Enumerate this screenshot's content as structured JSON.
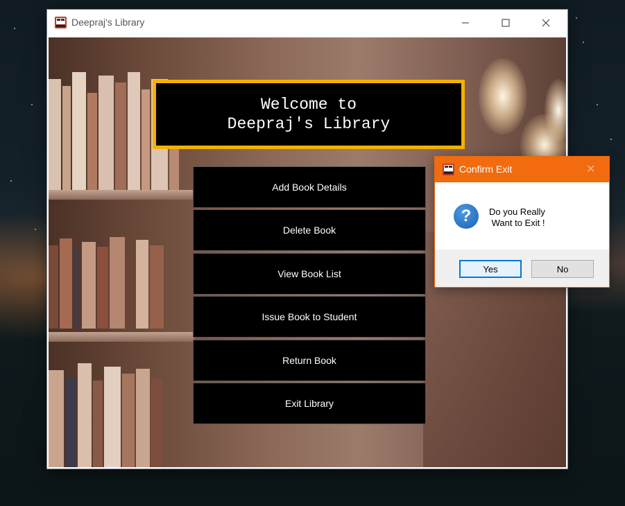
{
  "window": {
    "title": "Deepraj's Library",
    "controls": {
      "minimize": "—",
      "maximize": "☐",
      "close": "✕"
    }
  },
  "banner": {
    "line1": "Welcome to",
    "line2": "Deepraj's Library"
  },
  "menu": {
    "add_book": "Add Book Details",
    "delete_book": "Delete Book",
    "view_list": "View Book List",
    "issue_book": "Issue Book to Student",
    "return_book": "Return Book",
    "exit_library": "Exit Library"
  },
  "dialog": {
    "title": "Confirm Exit",
    "close": "✕",
    "icon": "?",
    "message": "Do you Really\n Want to Exit !",
    "yes_label": "Yes",
    "no_label": "No"
  },
  "colors": {
    "banner_border": "#f6b000",
    "dialog_titlebar": "#f26b0f",
    "button_bg": "#000000"
  },
  "icons": {
    "app": "app-logo-icon",
    "question": "question-icon"
  }
}
